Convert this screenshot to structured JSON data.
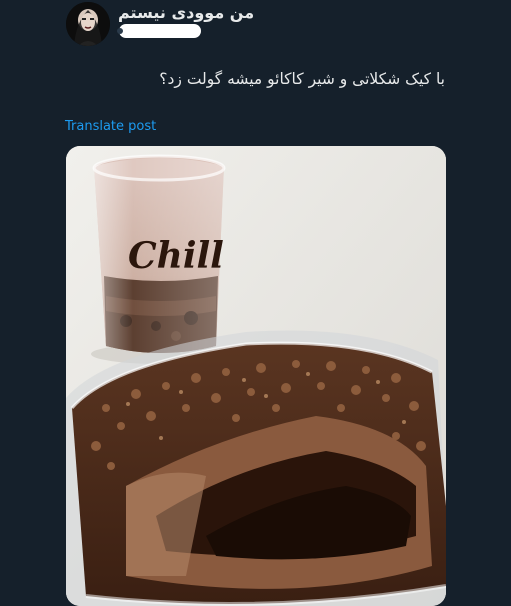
{
  "author": {
    "display_name": "من موودی نیستم"
  },
  "tweet": {
    "text": "با کیک شکلاتی و شیر کاکائو میشه گولت زد؟",
    "translate_label": "Translate post"
  },
  "media": {
    "glass_label": "Chill"
  },
  "colors": {
    "background": "#15202b",
    "text": "#e7e9ea",
    "link": "#1d9bf0"
  }
}
